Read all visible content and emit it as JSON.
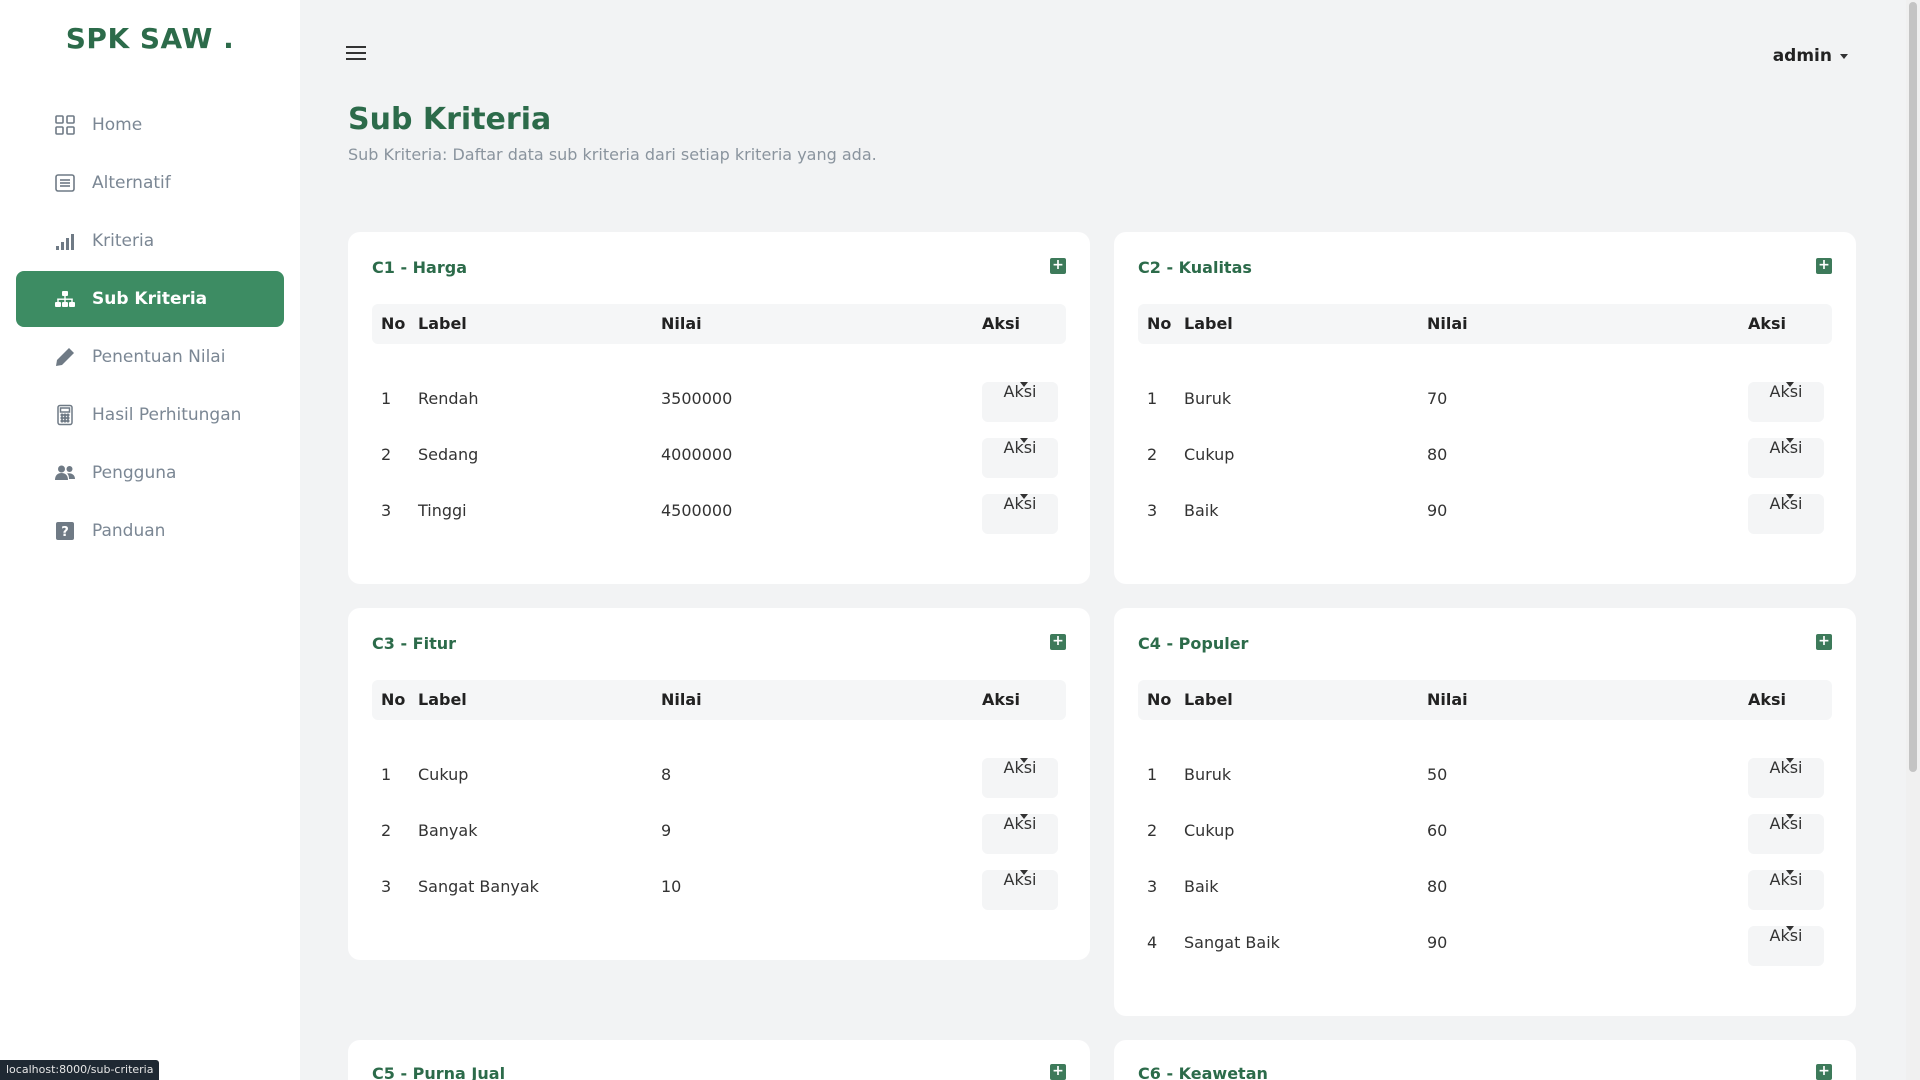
{
  "brand": "SPK SAW .",
  "nav": [
    {
      "label": "Home",
      "icon": "grid-icon"
    },
    {
      "label": "Alternatif",
      "icon": "list-icon"
    },
    {
      "label": "Kriteria",
      "icon": "bar-chart-icon"
    },
    {
      "label": "Sub Kriteria",
      "icon": "sitemap-icon",
      "active": true
    },
    {
      "label": "Penentuan Nilai",
      "icon": "pencil-icon"
    },
    {
      "label": "Hasil Perhitungan",
      "icon": "calculator-icon"
    },
    {
      "label": "Pengguna",
      "icon": "users-icon"
    },
    {
      "label": "Panduan",
      "icon": "question-icon"
    }
  ],
  "user": {
    "name": "admin"
  },
  "page": {
    "title": "Sub Kriteria",
    "subtitle": "Sub Kriteria: Daftar data sub kriteria dari setiap kriteria yang ada."
  },
  "table_headers": {
    "no": "No",
    "label": "Label",
    "nilai": "Nilai",
    "aksi": "Aksi"
  },
  "action_label": "Aksi",
  "cards": [
    {
      "title": "C1 - Harga",
      "rows": [
        {
          "no": "1",
          "label": "Rendah",
          "nilai": "3500000"
        },
        {
          "no": "2",
          "label": "Sedang",
          "nilai": "4000000"
        },
        {
          "no": "3",
          "label": "Tinggi",
          "nilai": "4500000"
        }
      ]
    },
    {
      "title": "C2 - Kualitas",
      "rows": [
        {
          "no": "1",
          "label": "Buruk",
          "nilai": "70"
        },
        {
          "no": "2",
          "label": "Cukup",
          "nilai": "80"
        },
        {
          "no": "3",
          "label": "Baik",
          "nilai": "90"
        }
      ]
    },
    {
      "title": "C3 - Fitur",
      "rows": [
        {
          "no": "1",
          "label": "Cukup",
          "nilai": "8"
        },
        {
          "no": "2",
          "label": "Banyak",
          "nilai": "9"
        },
        {
          "no": "3",
          "label": "Sangat Banyak",
          "nilai": "10"
        }
      ]
    },
    {
      "title": "C4 - Populer",
      "rows": [
        {
          "no": "1",
          "label": "Buruk",
          "nilai": "50"
        },
        {
          "no": "2",
          "label": "Cukup",
          "nilai": "60"
        },
        {
          "no": "3",
          "label": "Baik",
          "nilai": "80"
        },
        {
          "no": "4",
          "label": "Sangat Baik",
          "nilai": "90"
        }
      ]
    },
    {
      "title": "C5 - Purna Jual",
      "rows": []
    },
    {
      "title": "C6 - Keawetan",
      "rows": []
    }
  ],
  "status_url": "localhost:8000/sub-criteria",
  "colors": {
    "primary": "#3d8c63",
    "title": "#2c6b4a",
    "background": "#f2f3f4"
  }
}
